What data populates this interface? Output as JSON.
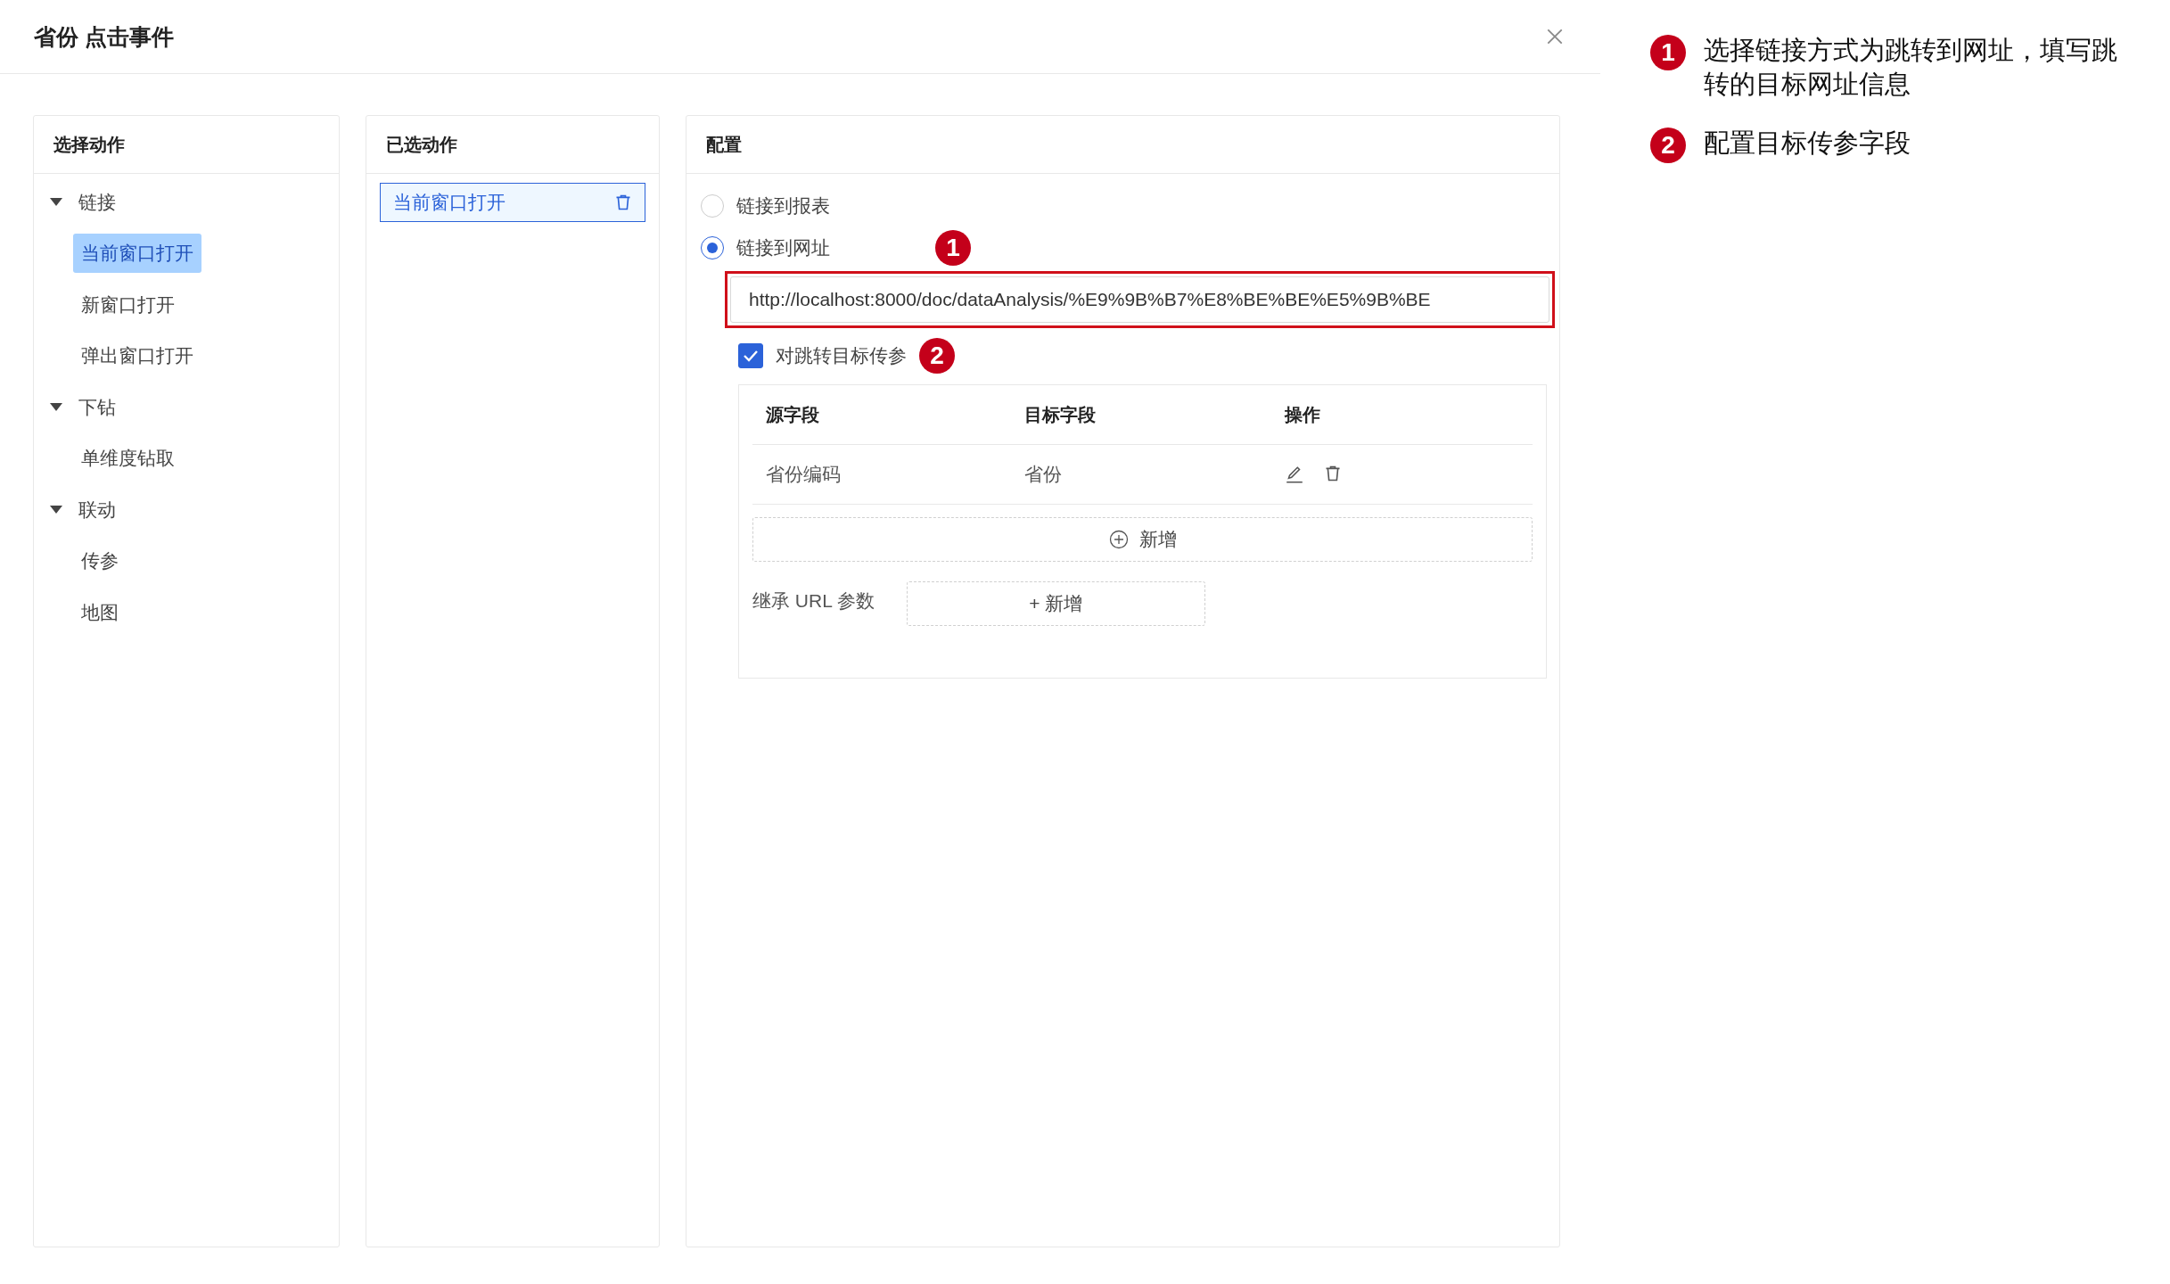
{
  "dialog": {
    "title": "省份 点击事件"
  },
  "select_actions": {
    "title": "选择动作",
    "tree": [
      {
        "label": "链接",
        "expanded": true,
        "children": [
          {
            "label": "当前窗口打开",
            "selected": true
          },
          {
            "label": "新窗口打开",
            "selected": false
          },
          {
            "label": "弹出窗口打开",
            "selected": false
          }
        ]
      },
      {
        "label": "下钻",
        "expanded": true,
        "children": [
          {
            "label": "单维度钻取",
            "selected": false
          }
        ]
      },
      {
        "label": "联动",
        "expanded": true,
        "children": [
          {
            "label": "传参",
            "selected": false
          },
          {
            "label": "地图",
            "selected": false
          }
        ]
      }
    ]
  },
  "selected_actions": {
    "title": "已选动作",
    "items": [
      {
        "label": "当前窗口打开"
      }
    ]
  },
  "config": {
    "title": "配置",
    "link_options": [
      {
        "label": "链接到报表",
        "selected": false
      },
      {
        "label": "链接到网址",
        "selected": true,
        "marker": "1"
      }
    ],
    "url": {
      "value": "http://localhost:8000/doc/dataAnalysis/%E9%9B%B7%E8%BE%BE%E5%9B%BE",
      "highlighted": true
    },
    "pass_params": {
      "label": "对跳转目标传参",
      "checked": true,
      "marker": "2"
    },
    "param_table": {
      "columns": [
        "源字段",
        "目标字段",
        "操作"
      ],
      "rows": [
        {
          "source": "省份编码",
          "target": "省份"
        }
      ]
    },
    "add_button": "新增",
    "inherit": {
      "label": "继承 URL 参数",
      "button": "+ 新增"
    }
  },
  "annotations": [
    {
      "number": "1",
      "text": "选择链接方式为跳转到网址，填写跳转的目标网址信息"
    },
    {
      "number": "2",
      "text": "配置目标传参字段"
    }
  ]
}
